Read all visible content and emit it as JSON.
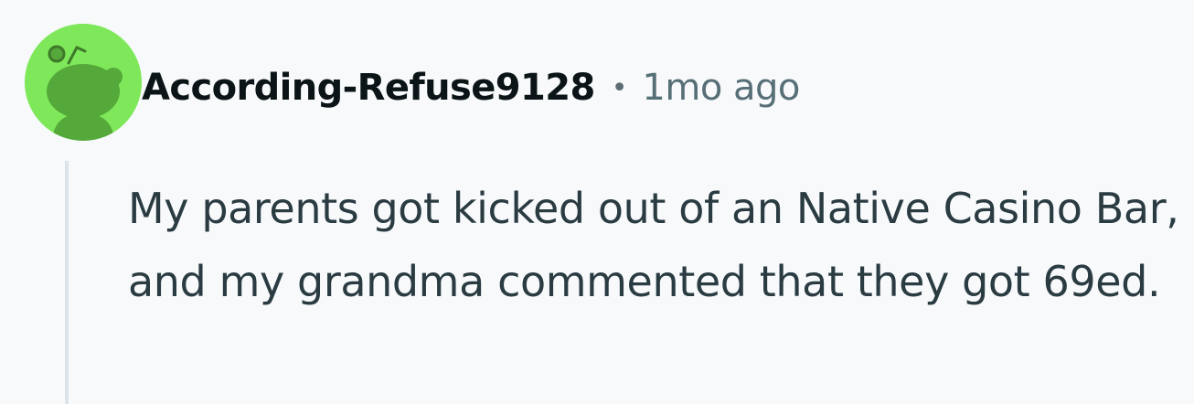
{
  "comment": {
    "username": "According-Refuse9128",
    "separator": "•",
    "timestamp": "1mo ago",
    "body": "My parents got kicked out of an Native Casino Bar, and my grandma commented that they got 69ed.",
    "avatar_icon": "reddit-snoo-avatar-icon",
    "avatar_bg": "#7ee85a"
  }
}
